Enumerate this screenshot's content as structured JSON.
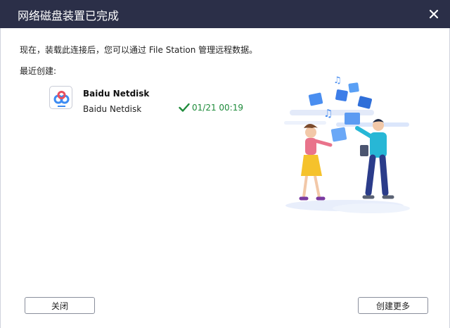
{
  "window": {
    "title": "网络磁盘装置已完成"
  },
  "main": {
    "message": "现在，装载此连接后，您可以通过 File Station 管理远程数据。",
    "recent_label": "最近创建:",
    "recent_item": {
      "icon": "baidu-netdisk-icon",
      "name": "Baidu Netdisk",
      "subtitle": "Baidu Netdisk",
      "status_icon": "checkmark-icon",
      "status_color": "#1e8b3a",
      "timestamp": "01/21 00:19"
    }
  },
  "footer": {
    "close_label": "关闭",
    "create_more_label": "创建更多"
  },
  "colors": {
    "titlebar": "#2b2f48",
    "accent_blue": "#3d8bf2"
  }
}
